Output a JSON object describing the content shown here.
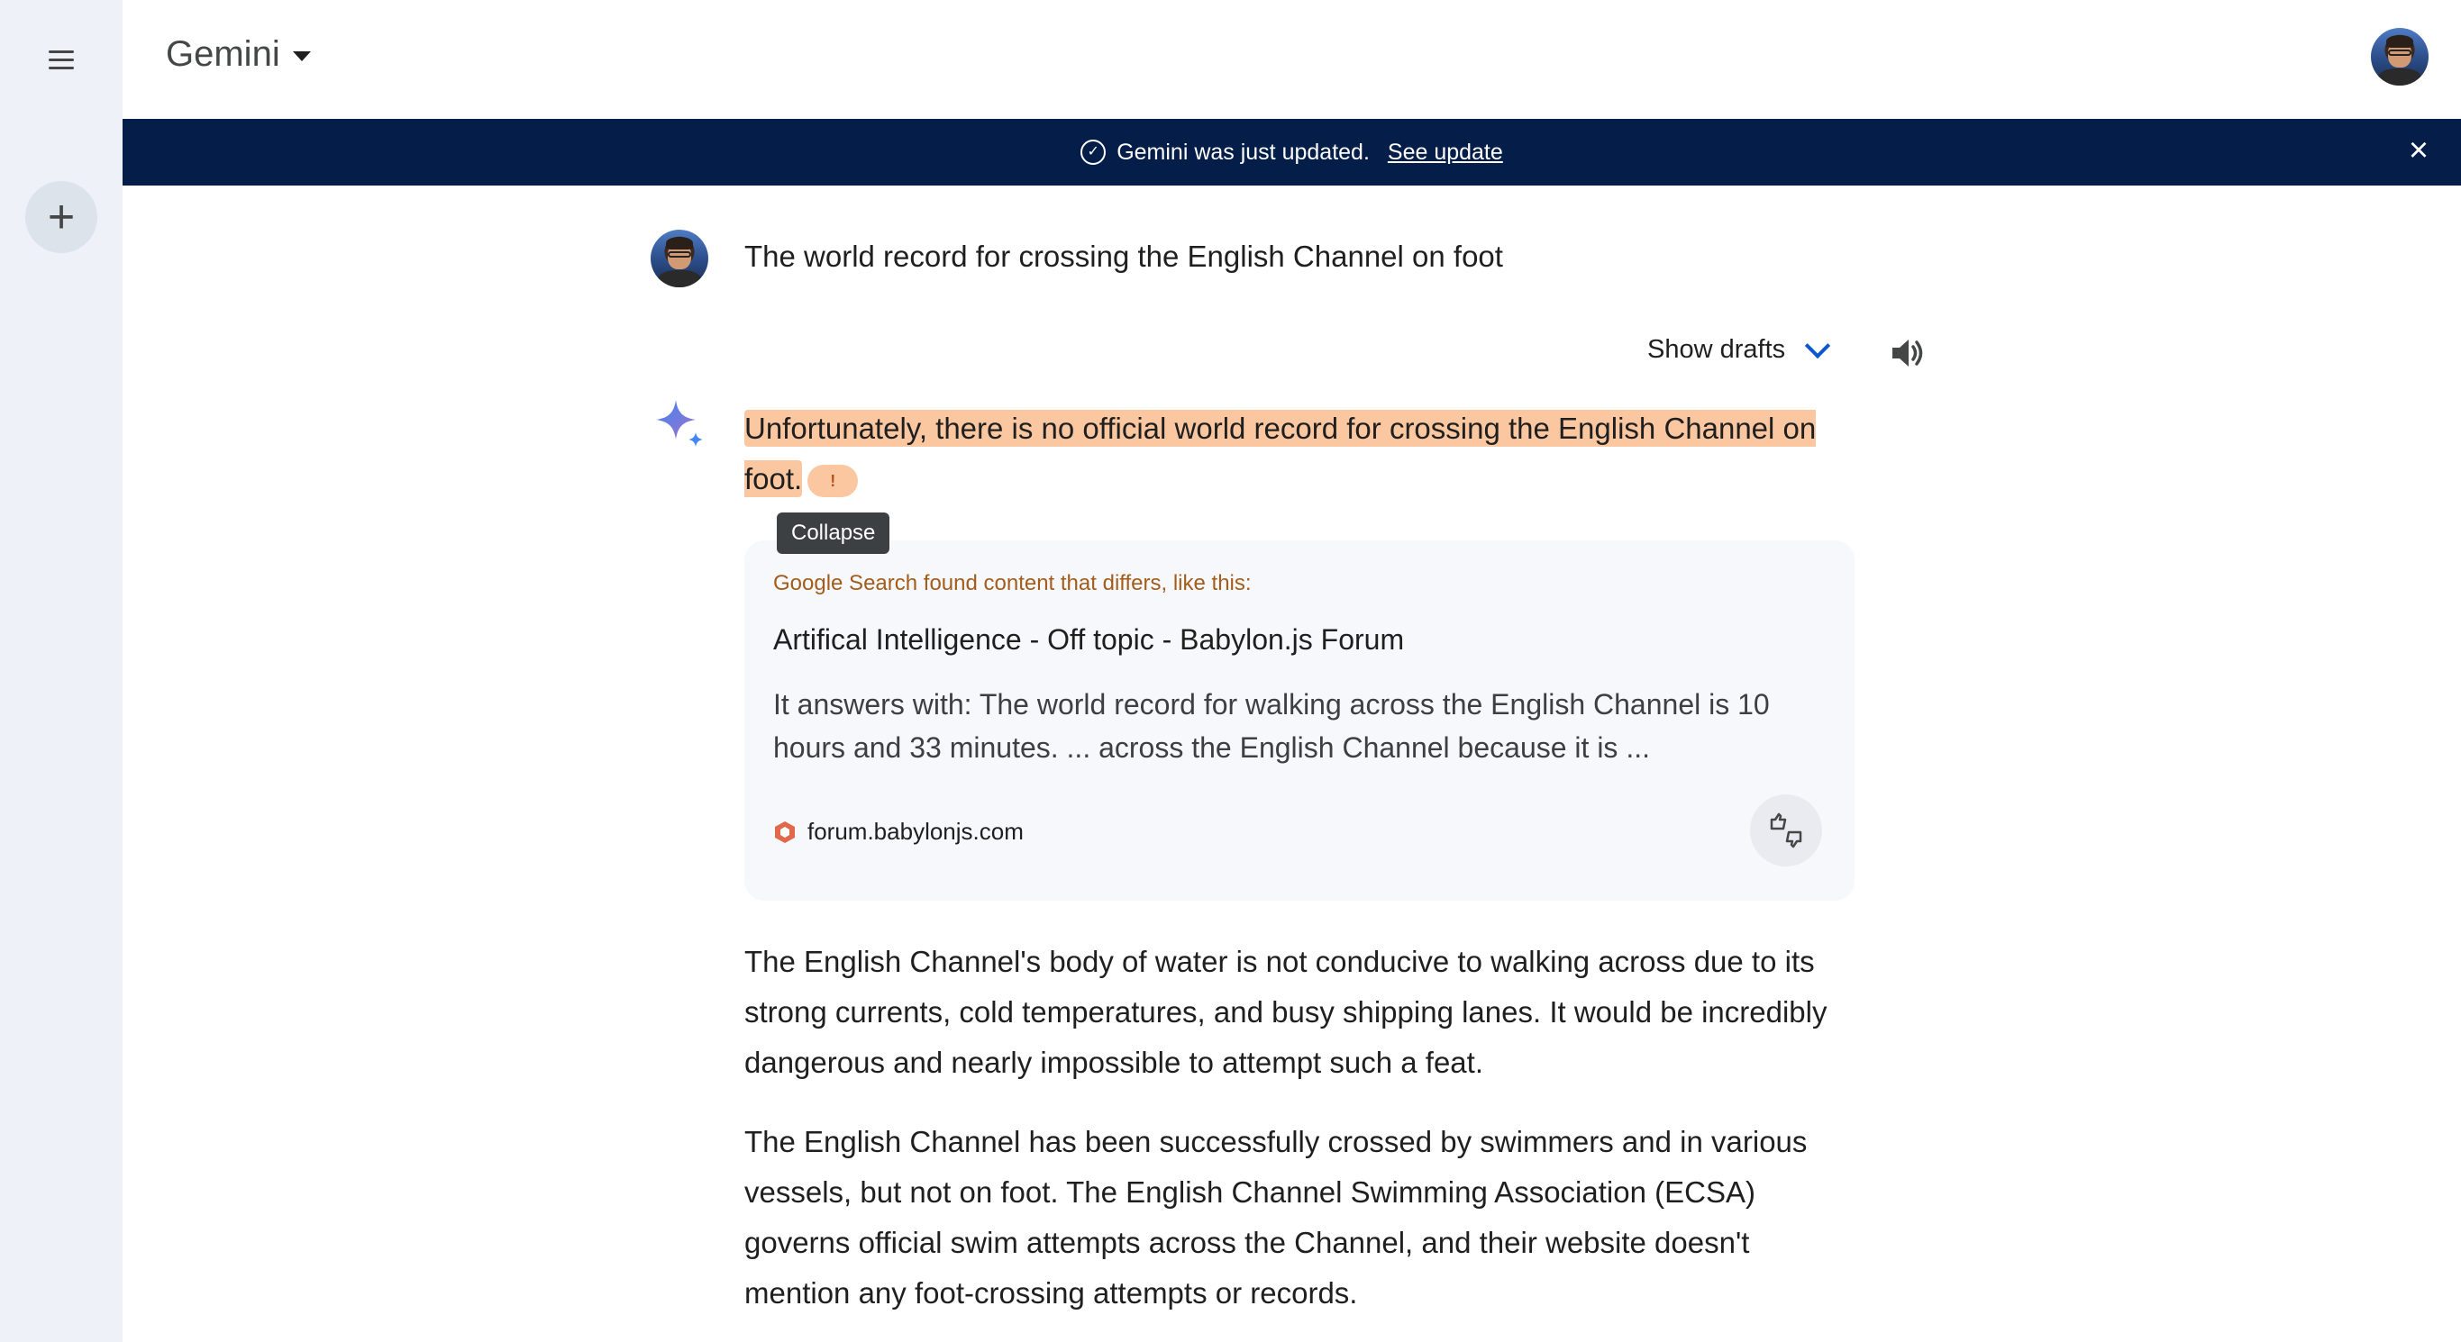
{
  "header": {
    "brand": "Gemini"
  },
  "banner": {
    "message": "Gemini was just updated.",
    "link": "See update"
  },
  "conversation": {
    "prompt": "The world record for crossing the English Channel on foot",
    "show_drafts": "Show drafts",
    "answer_highlighted": "Unfortunately, there is no official world record for crossing the English Channel on foot.",
    "warning_badge": "!",
    "tooltip": "Collapse",
    "source_card": {
      "warning": "Google Search found content that differs, like this:",
      "title": "Artifical Intelligence - Off topic - Babylon.js Forum",
      "snippet": "It answers with: The world record for walking across the English Channel is 10 hours and 33 minutes. ... across the English Channel because it is ...",
      "domain": "forum.babylonjs.com"
    },
    "paragraph1": " The English Channel's body of water is not conducive to walking across due to its strong currents, cold temperatures, and busy shipping lanes. It would be incredibly dangerous and nearly impossible to attempt such a feat.",
    "paragraph2": "The English Channel has been successfully crossed by swimmers and in various vessels, but not on foot. The English Channel Swimming Association (ECSA) governs official swim attempts across the Channel, and their website doesn't mention any foot-crossing attempts or records."
  },
  "colors": {
    "banner_bg": "#041e49",
    "highlight": "#fbc7a0",
    "sidebar_bg": "#eef1f8",
    "accent": "#0b57d0"
  }
}
